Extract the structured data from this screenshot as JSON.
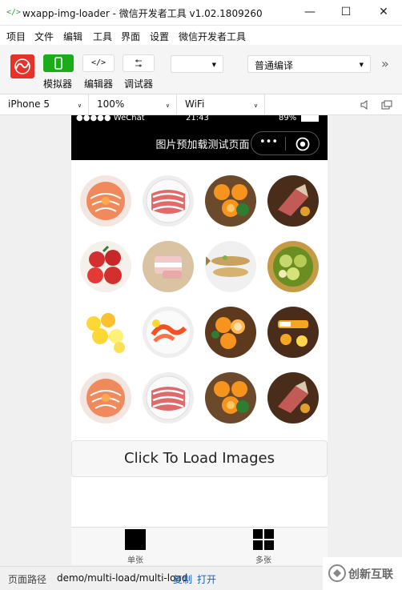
{
  "window": {
    "title": "wxapp-img-loader - 微信开发者工具 v1.02.1809260",
    "minimize": "—",
    "maximize": "☐",
    "close": "✕"
  },
  "menu": [
    "项目",
    "文件",
    "编辑",
    "工具",
    "界面",
    "设置",
    "微信开发者工具"
  ],
  "toolbar": {
    "simulator": "模拟器",
    "editor": "编辑器",
    "debugger": "调试器",
    "select1_value": "",
    "compile_mode": "普通编译",
    "more": "»"
  },
  "device_bar": {
    "device": "iPhone 5",
    "zoom": "100%",
    "network": "WiFi"
  },
  "phone": {
    "status": {
      "carrier": "●●●●● WeChat",
      "time": "21:43",
      "battery": "89%"
    },
    "nav_title": "图片预加载测试页面",
    "capsule_more": "•••",
    "load_button": "Click To Load Images",
    "tabs": [
      {
        "label": "单张"
      },
      {
        "label": "多张"
      }
    ],
    "images": [
      {
        "name": "salmon-plate-image",
        "kind": "salmon"
      },
      {
        "name": "beef-slices-image",
        "kind": "beef"
      },
      {
        "name": "oranges-bowl-image",
        "kind": "oranges"
      },
      {
        "name": "ham-leg-image",
        "kind": "ham"
      },
      {
        "name": "apples-bowl-image",
        "kind": "apples"
      },
      {
        "name": "pork-plate-image",
        "kind": "pork"
      },
      {
        "name": "fish-plate-image",
        "kind": "fish"
      },
      {
        "name": "pears-bowl-image",
        "kind": "pears"
      },
      {
        "name": "lemons-image",
        "kind": "lemons"
      },
      {
        "name": "shrimp-plate-image",
        "kind": "shrimp"
      },
      {
        "name": "orange-halves-image",
        "kind": "orangehalves"
      },
      {
        "name": "juice-tray-image",
        "kind": "juice"
      },
      {
        "name": "salmon-plate-image",
        "kind": "salmon"
      },
      {
        "name": "beef-slices-image",
        "kind": "beef"
      },
      {
        "name": "oranges-bowl-image",
        "kind": "oranges"
      },
      {
        "name": "ham-leg-image",
        "kind": "ham"
      }
    ]
  },
  "path_bar": {
    "label": "页面路径",
    "path": "demo/multi-load/multi-load",
    "copy": "复制",
    "open": "打开"
  },
  "watermark": "创新互联",
  "colors": {
    "accent_green": "#1aad19",
    "logo_red": "#e6332a",
    "navbar": "#000000"
  }
}
